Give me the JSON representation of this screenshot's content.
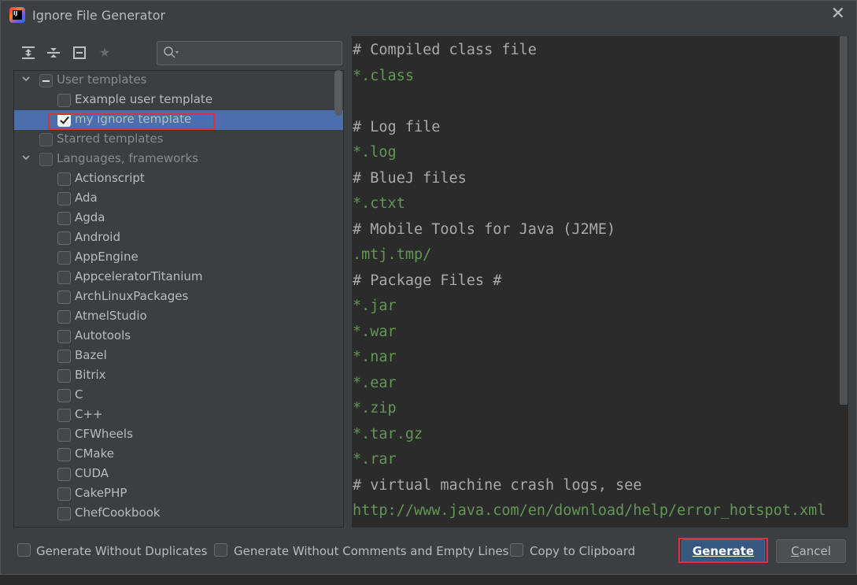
{
  "window": {
    "title": "Ignore File Generator",
    "app_icon_text": "IJ"
  },
  "toolbar": {
    "icons": [
      "expand-all-icon",
      "collapse-all-icon",
      "collapse-icon",
      "star-icon"
    ],
    "search_value": ""
  },
  "tree": {
    "rows": [
      {
        "label": "User templates",
        "level": 0,
        "expanded": true,
        "check": "partial",
        "style": "dim"
      },
      {
        "label": "Example user template",
        "level": 1,
        "check": "none",
        "style": "normal"
      },
      {
        "label": "my ignore template",
        "level": 1,
        "check": "checked",
        "style": "normal",
        "selected": true
      },
      {
        "label": "Starred templates",
        "level": 0,
        "check": "none",
        "style": "dim"
      },
      {
        "label": "Languages, frameworks",
        "level": 0,
        "expanded": true,
        "check": "none",
        "style": "dim"
      },
      {
        "label": "Actionscript",
        "level": 1,
        "check": "none",
        "style": "normal"
      },
      {
        "label": "Ada",
        "level": 1,
        "check": "none",
        "style": "normal"
      },
      {
        "label": "Agda",
        "level": 1,
        "check": "none",
        "style": "normal"
      },
      {
        "label": "Android",
        "level": 1,
        "check": "none",
        "style": "normal"
      },
      {
        "label": "AppEngine",
        "level": 1,
        "check": "none",
        "style": "normal"
      },
      {
        "label": "AppceleratorTitanium",
        "level": 1,
        "check": "none",
        "style": "normal"
      },
      {
        "label": "ArchLinuxPackages",
        "level": 1,
        "check": "none",
        "style": "normal"
      },
      {
        "label": "AtmelStudio",
        "level": 1,
        "check": "none",
        "style": "normal"
      },
      {
        "label": "Autotools",
        "level": 1,
        "check": "none",
        "style": "normal"
      },
      {
        "label": "Bazel",
        "level": 1,
        "check": "none",
        "style": "normal"
      },
      {
        "label": "Bitrix",
        "level": 1,
        "check": "none",
        "style": "normal"
      },
      {
        "label": "C",
        "level": 1,
        "check": "none",
        "style": "normal"
      },
      {
        "label": "C++",
        "level": 1,
        "check": "none",
        "style": "normal"
      },
      {
        "label": "CFWheels",
        "level": 1,
        "check": "none",
        "style": "normal"
      },
      {
        "label": "CMake",
        "level": 1,
        "check": "none",
        "style": "normal"
      },
      {
        "label": "CUDA",
        "level": 1,
        "check": "none",
        "style": "normal"
      },
      {
        "label": "CakePHP",
        "level": 1,
        "check": "none",
        "style": "normal"
      },
      {
        "label": "ChefCookbook",
        "level": 1,
        "check": "none",
        "style": "normal"
      }
    ]
  },
  "editor": {
    "lines": [
      {
        "text": "# Compiled class file",
        "kind": "comment"
      },
      {
        "text": "*.class",
        "kind": "pattern"
      },
      {
        "text": "",
        "kind": "pattern"
      },
      {
        "text": "# Log file",
        "kind": "comment"
      },
      {
        "text": "*.log",
        "kind": "pattern"
      },
      {
        "text": "# BlueJ files",
        "kind": "comment"
      },
      {
        "text": "*.ctxt",
        "kind": "pattern"
      },
      {
        "text": "# Mobile Tools for Java (J2ME)",
        "kind": "comment"
      },
      {
        "text": ".mtj.tmp/",
        "kind": "pattern"
      },
      {
        "text": "# Package Files #",
        "kind": "comment"
      },
      {
        "text": "*.jar",
        "kind": "pattern"
      },
      {
        "text": "*.war",
        "kind": "pattern"
      },
      {
        "text": "*.nar",
        "kind": "pattern"
      },
      {
        "text": "*.ear",
        "kind": "pattern"
      },
      {
        "text": "*.zip",
        "kind": "pattern"
      },
      {
        "text": "*.tar.gz",
        "kind": "pattern"
      },
      {
        "text": "*.rar",
        "kind": "pattern"
      },
      {
        "text": "# virtual machine crash logs, see",
        "kind": "comment"
      },
      {
        "text": "http://www.java.com/en/download/help/error_hotspot.xml",
        "kind": "pattern"
      }
    ]
  },
  "options": {
    "without_duplicates": "Generate Without Duplicates",
    "without_comments": "Generate Without Comments and Empty Lines",
    "copy_clipboard": "Copy to Clipboard"
  },
  "buttons": {
    "generate": "Generate",
    "cancel_first": "C",
    "cancel_rest": "ancel"
  },
  "colors": {
    "accent_selection": "#4b6eaf",
    "primary_button": "#365880",
    "highlight_box": "#e0303b",
    "pattern_text": "#629755"
  }
}
